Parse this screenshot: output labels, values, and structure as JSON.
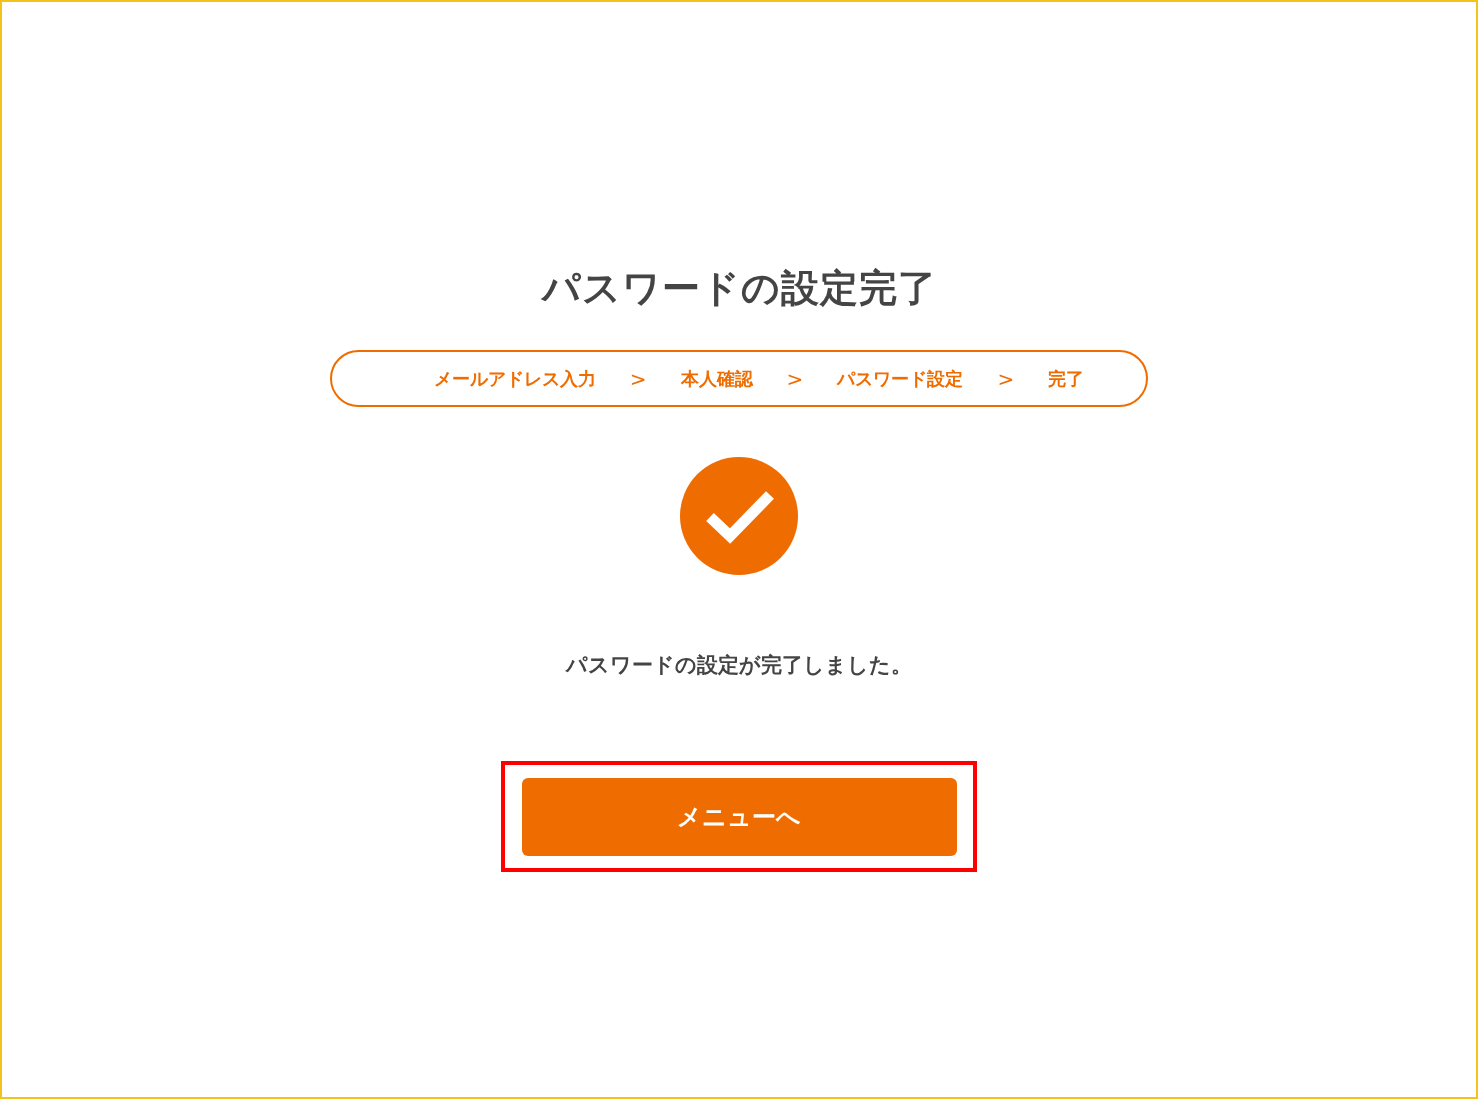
{
  "title": "パスワードの設定完了",
  "steps": [
    {
      "label": "メールアドレス入力"
    },
    {
      "label": "本人確認"
    },
    {
      "label": "パスワード設定"
    },
    {
      "label": "完了"
    }
  ],
  "step_separator": ">",
  "message": "パスワードの設定が完了しました。",
  "menu_button": {
    "label": "メニューへ",
    "highlighted": true
  }
}
